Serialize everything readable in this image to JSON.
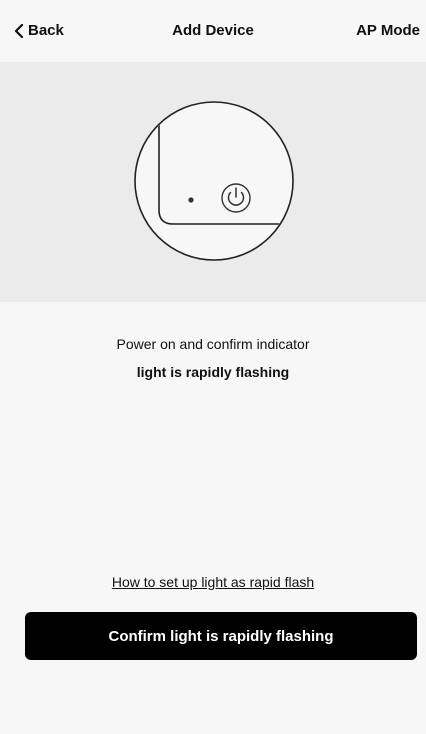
{
  "nav": {
    "back_label": "Back",
    "title": "Add Device",
    "right_label": "AP Mode"
  },
  "illustration": {
    "icons": [
      "indicator-dot-icon",
      "power-button-icon"
    ]
  },
  "instructions": {
    "line1": "Power on and confirm indicator",
    "line2": "light is rapidly flashing"
  },
  "help_link": "How to set up light as rapid flash",
  "confirm_button": "Confirm light is rapidly flashing",
  "colors": {
    "background": "#f7f7f7",
    "illustration_bg": "#ebebeb",
    "button_bg": "#000000",
    "button_text": "#ffffff"
  }
}
